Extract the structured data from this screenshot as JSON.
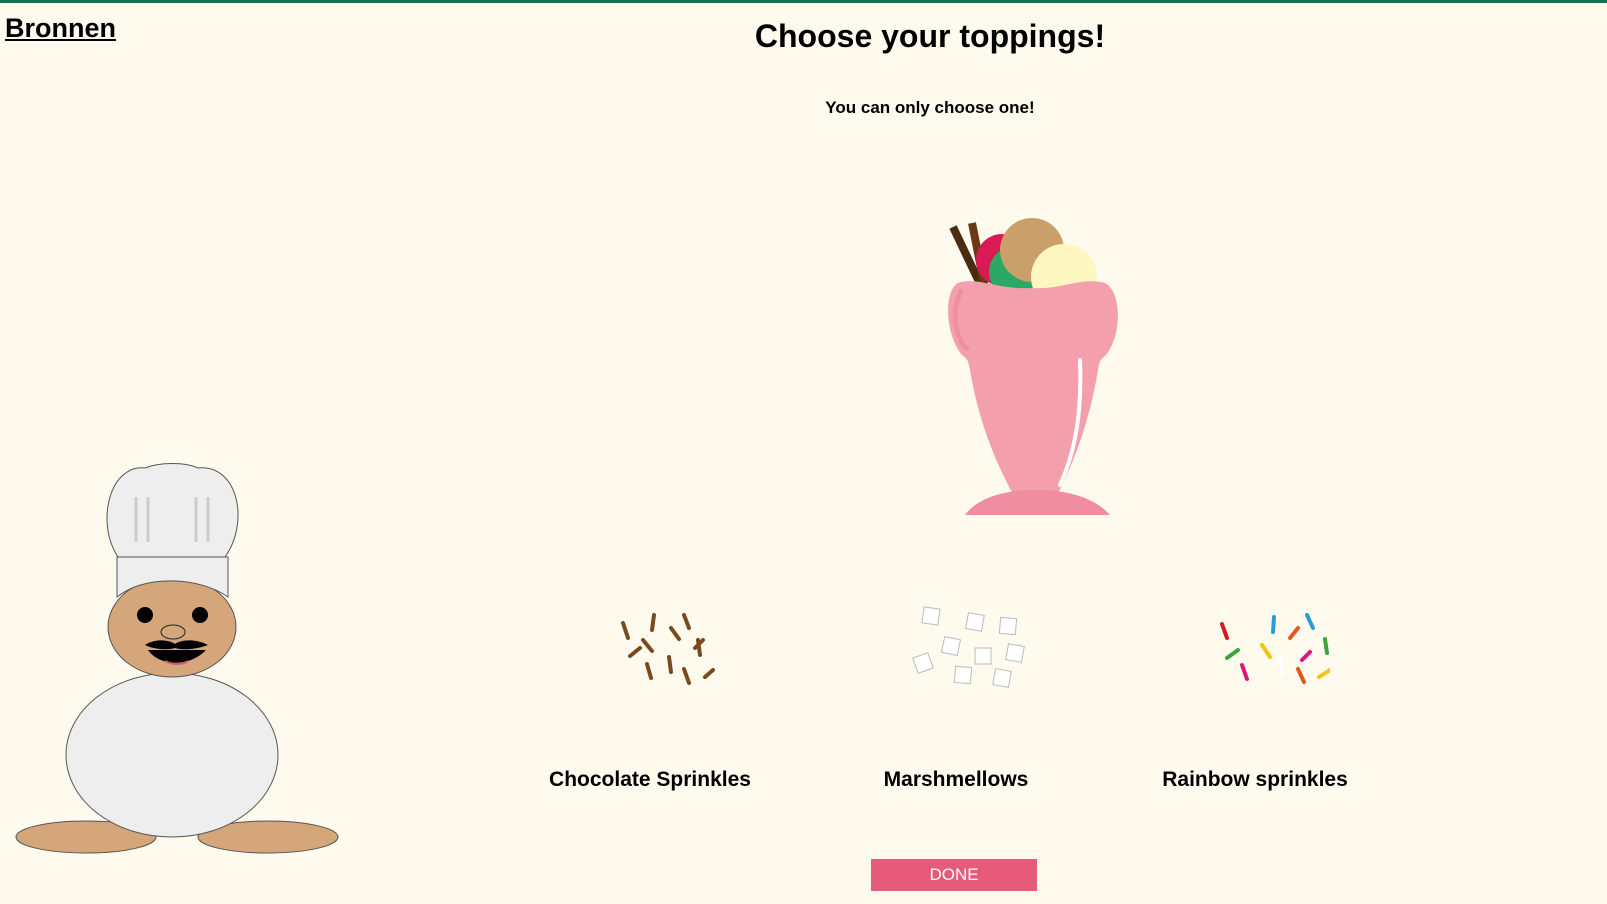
{
  "header": {
    "sources_link": "Bronnen",
    "title": "Choose your toppings!",
    "subtitle": "You can only choose one!"
  },
  "toppings": [
    {
      "label": "Chocolate Sprinkles",
      "icon": "chocolate-sprinkles-icon"
    },
    {
      "label": "Marshmellows",
      "icon": "marshmallows-icon"
    },
    {
      "label": "Rainbow sprinkles",
      "icon": "rainbow-sprinkles-icon"
    }
  ],
  "done_button": {
    "label": "DONE"
  },
  "colors": {
    "background": "#fffaee",
    "top_bar": "#1c6b52",
    "done_button": "#e65a7a",
    "glass": "#f4a0ac",
    "skin": "#d4a679"
  }
}
